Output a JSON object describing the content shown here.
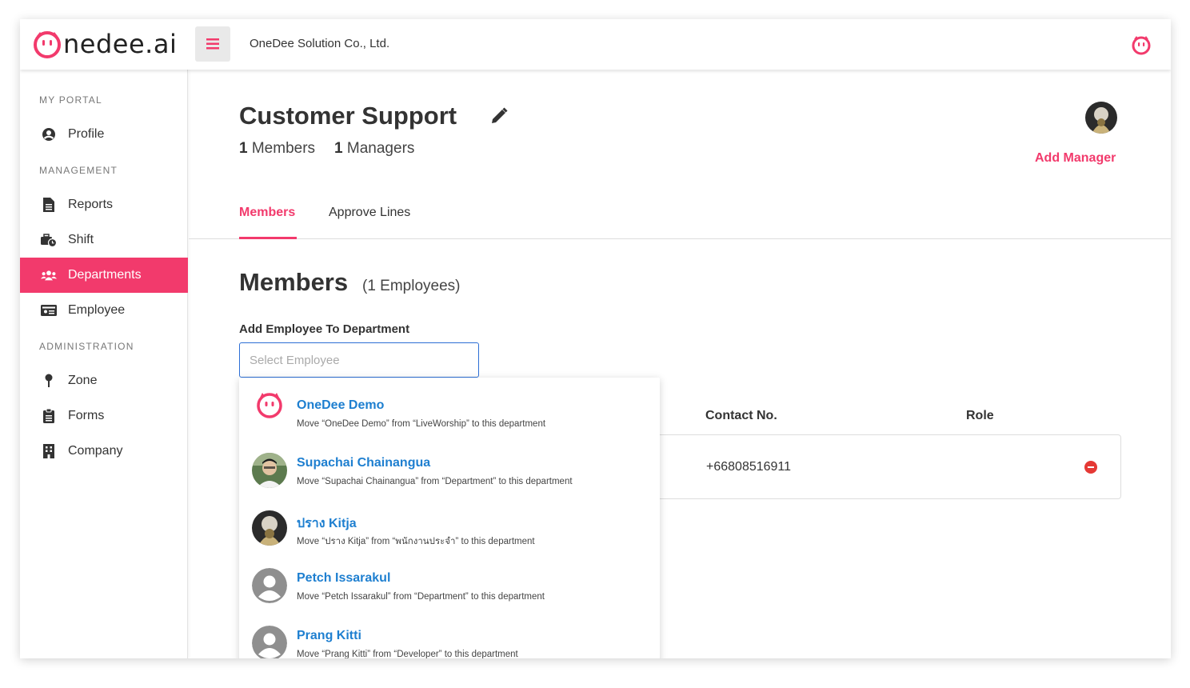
{
  "brand": {
    "logo_text": "nedee.ai",
    "accent_color": "#f23a6c",
    "link_color": "#1e7fd0"
  },
  "header": {
    "company_name": "OneDee Solution Co., Ltd."
  },
  "sidebar": {
    "sections": {
      "portal": "MY PORTAL",
      "management": "MANAGEMENT",
      "administration": "ADMINISTRATION"
    },
    "items": [
      {
        "label": "Profile",
        "icon": "user-circle-icon"
      },
      {
        "label": "Reports",
        "icon": "document-icon"
      },
      {
        "label": "Shift",
        "icon": "shift-clock-icon"
      },
      {
        "label": "Departments",
        "icon": "users-group-icon",
        "active": true
      },
      {
        "label": "Employee",
        "icon": "id-card-icon"
      },
      {
        "label": "Zone",
        "icon": "map-pin-icon"
      },
      {
        "label": "Forms",
        "icon": "clipboard-icon"
      },
      {
        "label": "Company",
        "icon": "building-icon"
      }
    ]
  },
  "department": {
    "title": "Customer Support",
    "members_count": "1",
    "members_label": "Members",
    "managers_count": "1",
    "managers_label": "Managers",
    "add_manager": "Add Manager"
  },
  "tabs": [
    {
      "label": "Members",
      "active": true
    },
    {
      "label": "Approve Lines",
      "active": false
    }
  ],
  "members": {
    "heading": "Members",
    "subheading": "(1 Employees)",
    "add_label": "Add Employee To Department",
    "select_placeholder": "Select Employee",
    "columns": {
      "contact": "Contact No.",
      "role": "Role"
    },
    "rows": [
      {
        "contact": "+66808516911"
      }
    ]
  },
  "dropdown": {
    "options": [
      {
        "name": "OneDee Demo",
        "desc": "Move “OneDee Demo” from “LiveWorship” to this department",
        "avatar": "onedee-logo"
      },
      {
        "name": "Supachai Chainangua",
        "desc": "Move “Supachai Chainangua” from “Department” to this department",
        "avatar": "photo"
      },
      {
        "name": "ปราง Kitja",
        "desc": "Move “ปราง Kitja” from “พนักงานประจำ” to this department",
        "avatar": "photo"
      },
      {
        "name": "Petch Issarakul",
        "desc": "Move “Petch Issarakul” from “Department” to this department",
        "avatar": "default"
      },
      {
        "name": "Prang Kitti",
        "desc": "Move “Prang Kitti” from “Developer” to this department",
        "avatar": "default"
      }
    ]
  }
}
